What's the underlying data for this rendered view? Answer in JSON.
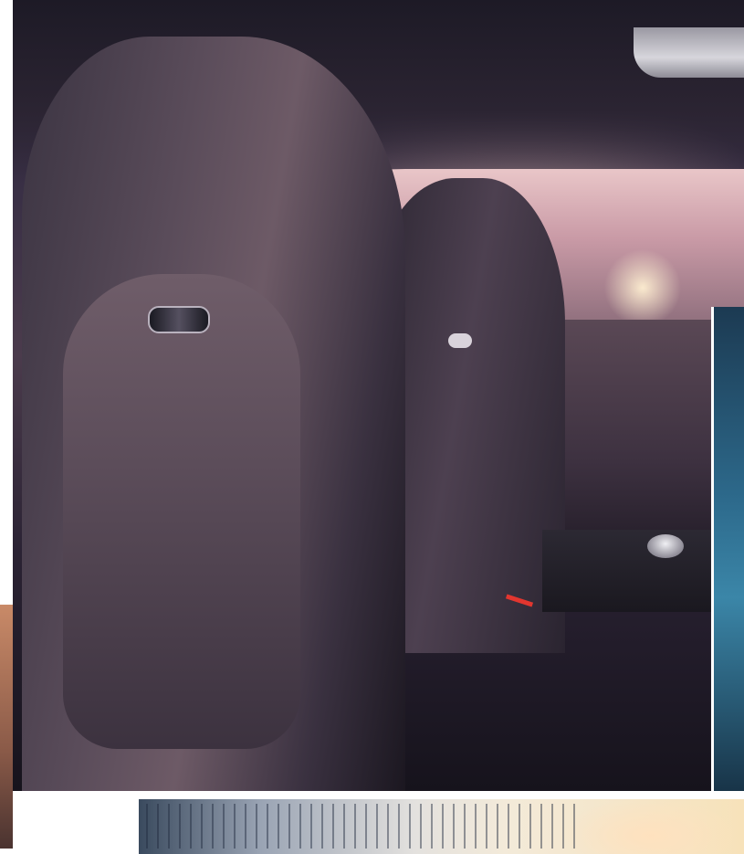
{
  "scene": {
    "main_photo": "car-interior-sport-seats",
    "right_photo": "blue-detail-thumbnail",
    "bottom_photo": "city-skyline-thumbnail",
    "left_photo": "warm-tone-thumbnail"
  },
  "colors": {
    "upholstery": "#5a4c5a",
    "window_glow": "#e9c6c8",
    "accent_red": "#e2362f",
    "right_photo_blue": "#2d6a8c",
    "bottom_photo_warm": "#f7e2b9"
  }
}
